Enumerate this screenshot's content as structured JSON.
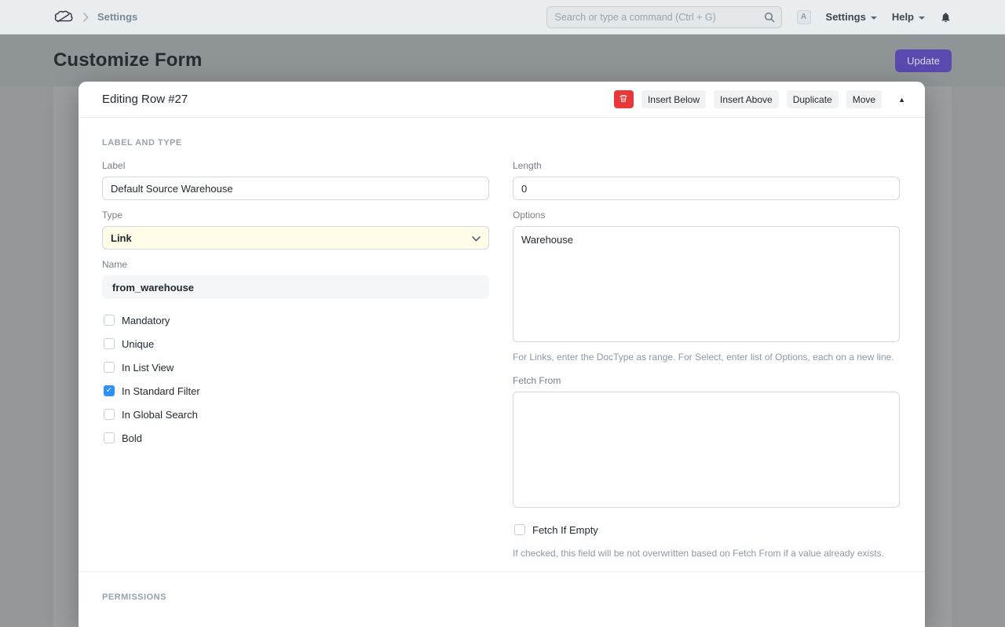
{
  "navbar": {
    "breadcrumb": "Settings",
    "search": {
      "placeholder": "Search or type a command (Ctrl + G)"
    },
    "avatar_letter": "A",
    "settings_dropdown": "Settings",
    "help_dropdown": "Help"
  },
  "page": {
    "title": "Customize Form",
    "update_button": "Update"
  },
  "modal": {
    "title": "Editing Row #27",
    "toolbar": {
      "insert_below": "Insert Below",
      "insert_above": "Insert Above",
      "duplicate": "Duplicate",
      "move": "Move"
    },
    "sections": {
      "label_and_type": "LABEL AND TYPE",
      "permissions": "PERMISSIONS"
    },
    "fields": {
      "label": {
        "label": "Label",
        "value": "Default Source Warehouse"
      },
      "type": {
        "label": "Type",
        "value": "Link"
      },
      "name": {
        "label": "Name",
        "value": "from_warehouse"
      },
      "length": {
        "label": "Length",
        "value": "0"
      },
      "options": {
        "label": "Options",
        "value": "Warehouse",
        "help": "For Links, enter the DocType as range. For Select, enter list of Options, each on a new line."
      },
      "fetch_from": {
        "label": "Fetch From",
        "value": ""
      },
      "fetch_if_empty": {
        "label": "Fetch If Empty",
        "checked": false,
        "help": "If checked, this field will be not overwritten based on Fetch From if a value already exists."
      }
    },
    "checkboxes": [
      {
        "label": "Mandatory",
        "checked": false
      },
      {
        "label": "Unique",
        "checked": false
      },
      {
        "label": "In List View",
        "checked": false
      },
      {
        "label": "In Standard Filter",
        "checked": true
      },
      {
        "label": "In Global Search",
        "checked": false
      },
      {
        "label": "Bold",
        "checked": false
      }
    ]
  },
  "colors": {
    "accent": "#5a4ab0",
    "danger": "#e8383a",
    "check": "#2e90fa",
    "select-bg": "#fffce7"
  }
}
